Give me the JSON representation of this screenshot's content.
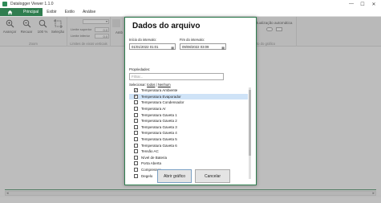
{
  "window": {
    "title": "Datalogger Viewer 1.1.0",
    "controls": [
      "—",
      "☐",
      "✕"
    ]
  },
  "menu": {
    "tabs": [
      "Principal",
      "Exibir",
      "Estilo",
      "Análise"
    ]
  },
  "ribbon": {
    "zoom_group": {
      "label": "Zoom",
      "buttons": [
        {
          "label": "Avançar",
          "icon": "zoom-in-icon"
        },
        {
          "label": "Recuar",
          "icon": "zoom-out-icon"
        },
        {
          "label": "100 %",
          "icon": "zoom-100-icon"
        },
        {
          "label": "Seleção",
          "icon": "selection-icon"
        }
      ]
    },
    "limits_group": {
      "label": "Limites de eixos verticais",
      "upper_label": "Limite superior",
      "upper_value": "0.0",
      "lower_label": "Limite inferior",
      "lower_value": "0.0"
    },
    "partial_left_label": "Amb",
    "auto_update_label": "tualização automática",
    "graph_label": "to do gráfico"
  },
  "dialog": {
    "title": "Dados do arquivo",
    "start_label": "Início do intervalo:",
    "start_value": "01/01/2022 01:01",
    "end_label": "Fim do intervalo:",
    "end_value": "09/08/2022 03:09",
    "properties_label": "Propriedades:",
    "filter_placeholder": "Filtrar...",
    "select_prefix": "Selecionar:",
    "select_all": "todos",
    "select_none": "Nenhum",
    "properties": [
      {
        "label": "Temperatura Ambiente",
        "checked": true,
        "selected": false
      },
      {
        "label": "Temperatura Evaporador",
        "checked": true,
        "selected": true
      },
      {
        "label": "Temperatura Condensador",
        "checked": false,
        "selected": false
      },
      {
        "label": "Temperatura Ar",
        "checked": false,
        "selected": false
      },
      {
        "label": "Temperatura Gaveta 1",
        "checked": false,
        "selected": false
      },
      {
        "label": "Temperatura Gaveta 2",
        "checked": false,
        "selected": false
      },
      {
        "label": "Temperatura Gaveta 3",
        "checked": false,
        "selected": false
      },
      {
        "label": "Temperatura Gaveta 4",
        "checked": false,
        "selected": false
      },
      {
        "label": "Temperatura Gaveta 5",
        "checked": false,
        "selected": false
      },
      {
        "label": "Temperatura Gaveta 6",
        "checked": false,
        "selected": false
      },
      {
        "label": "Tensão AC",
        "checked": false,
        "selected": false
      },
      {
        "label": "Nível de Bateria",
        "checked": false,
        "selected": false
      },
      {
        "label": "Porta Aberta",
        "checked": false,
        "selected": false
      },
      {
        "label": "Compressor",
        "checked": false,
        "selected": false
      },
      {
        "label": "Degelo",
        "checked": false,
        "selected": false
      }
    ],
    "open_button": "Abrir gráfico",
    "cancel_button": "Cancelar"
  },
  "colors": {
    "accent": "#2f7d4f",
    "selection": "#cfe3f7"
  }
}
